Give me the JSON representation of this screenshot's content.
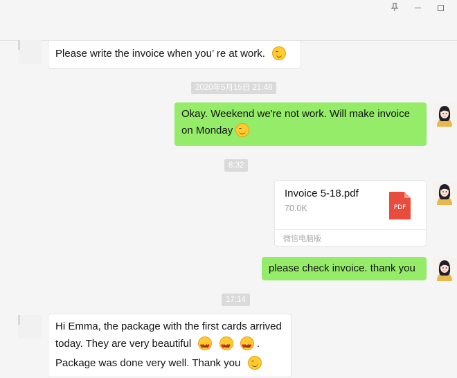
{
  "window": {
    "pin_icon": "pin-icon",
    "minimize_icon": "minimize-icon",
    "maximize_icon": "maximize-icon"
  },
  "messages": [
    {
      "sender": "contact",
      "text": "Please write the invoice when you’ re at work.",
      "emoji": [
        "wink-emoji"
      ]
    },
    {
      "type": "timestamp",
      "text": "2020年5月15日 21:48"
    },
    {
      "sender": "me",
      "lines": [
        "Okay.  Weekend we're not work. Will make invoice",
        "on Monday"
      ],
      "emoji": [
        "smile-emoji"
      ]
    },
    {
      "type": "timestamp",
      "text": "8:32"
    },
    {
      "sender": "me",
      "type": "file",
      "file_name": "Invoice 5-18.pdf",
      "file_size": "70.0K",
      "file_type": "PDF",
      "source": "微信电脑版"
    },
    {
      "sender": "me",
      "text": "please check invoice. thank you"
    },
    {
      "type": "timestamp",
      "text": "17:14"
    },
    {
      "sender": "contact",
      "lines": [
        "Hi Emma, the package with the first cards arrived",
        "today. They are very beautiful",
        "Package was done very well. Thank you"
      ],
      "line2_suffix": ".",
      "emoji": [
        "heart-eyes-emoji",
        "heart-eyes-emoji",
        "heart-eyes-emoji",
        "smile-emoji"
      ]
    }
  ],
  "colors": {
    "background": "#f5f5f5",
    "outgoing_bubble": "#95ec69",
    "incoming_bubble": "#ffffff",
    "timestamp_bg": "#dadada",
    "pdf_red": "#e84c3d"
  }
}
